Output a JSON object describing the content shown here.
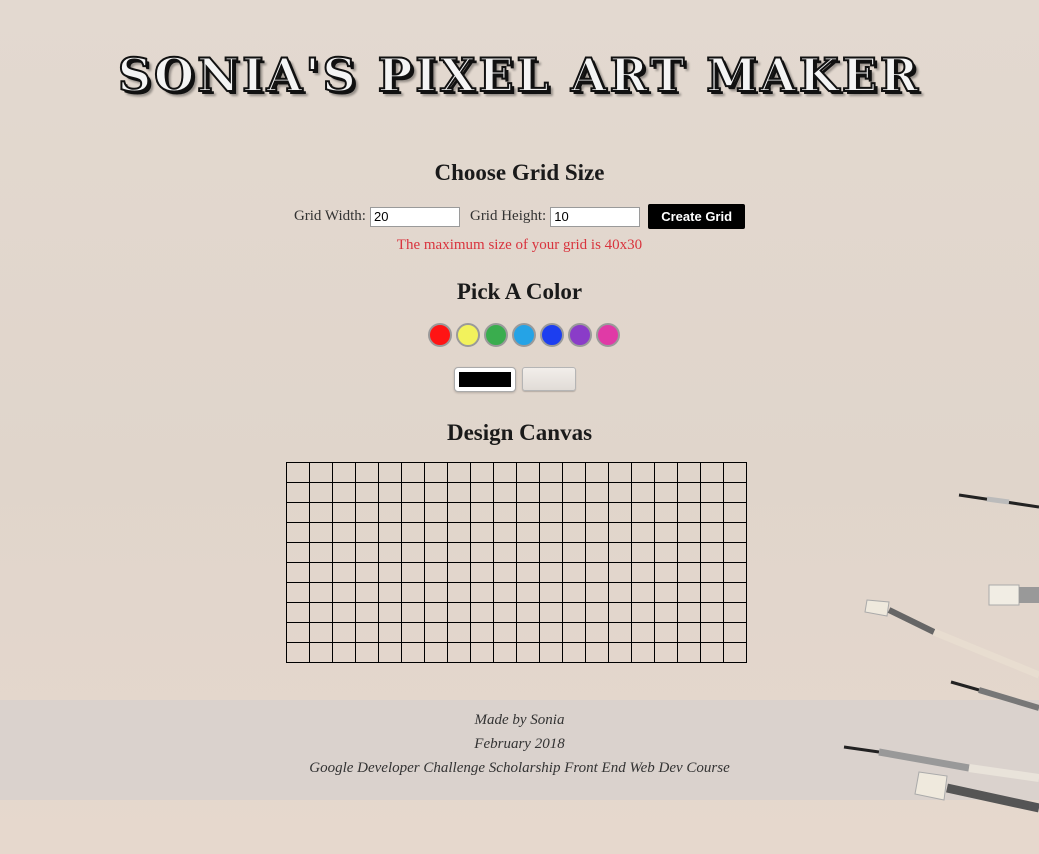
{
  "header": {
    "title": "Sonia's Pixel Art Maker"
  },
  "grid_size": {
    "heading": "Choose Grid Size",
    "width_label": "Grid Width:",
    "width_value": "20",
    "height_label": "Grid Height:",
    "height_value": "10",
    "create_label": "Create Grid",
    "max_note": "The maximum size of your grid is 40x30"
  },
  "color": {
    "heading": "Pick A Color",
    "swatches": [
      {
        "name": "red",
        "hex": "#ff1414"
      },
      {
        "name": "yellow",
        "hex": "#f2f25c"
      },
      {
        "name": "green",
        "hex": "#3aad4e"
      },
      {
        "name": "light-blue",
        "hex": "#25a3e6"
      },
      {
        "name": "blue",
        "hex": "#1c3ef0"
      },
      {
        "name": "purple",
        "hex": "#8a3cc8"
      },
      {
        "name": "pink",
        "hex": "#e03aa6"
      }
    ],
    "selected_color": "#000000"
  },
  "canvas": {
    "heading": "Design Canvas",
    "columns": 20,
    "rows": 10
  },
  "footer": {
    "line1": "Made by Sonia",
    "line2": "February 2018",
    "line3": "Google Developer Challenge Scholarship Front End Web Dev Course"
  }
}
